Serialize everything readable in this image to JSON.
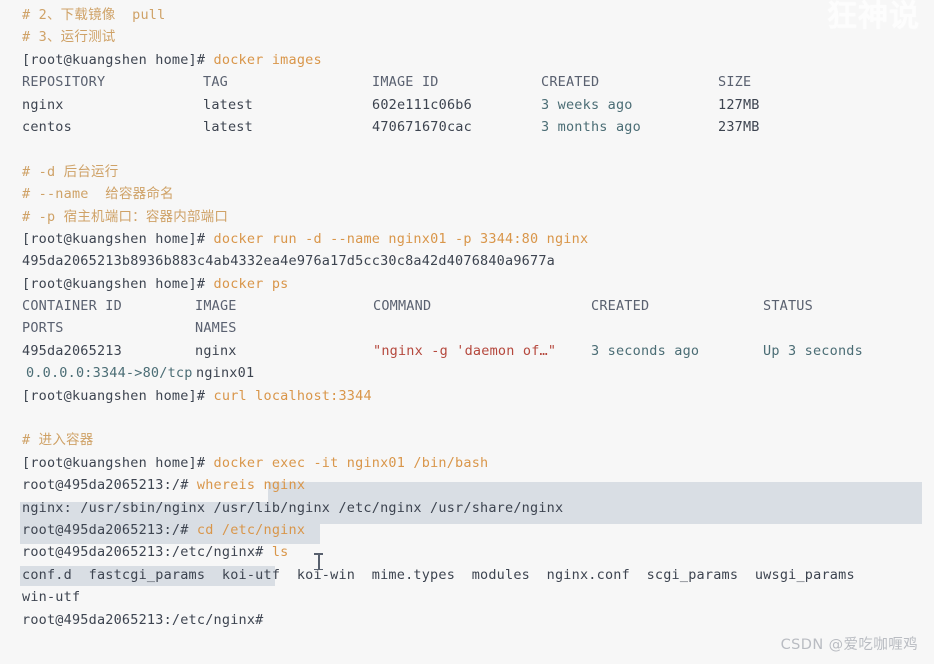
{
  "terminal": {
    "host_prompt": "[root@kuangshen home]# ",
    "container_prompt_root": "root@495da2065213:/# ",
    "container_prompt_nginx": "root@495da2065213:/etc/nginx# ",
    "lines": {
      "c1": "# 2、下载镜像  pull",
      "c2": "# 3、运行测试",
      "cmd_images": "docker images",
      "images_header": {
        "repository": "REPOSITORY",
        "tag": "TAG",
        "image_id": "IMAGE ID",
        "created": "CREATED",
        "size": "SIZE"
      },
      "images_rows": [
        {
          "repository": "nginx",
          "tag": "latest",
          "image_id": "602e111c06b6",
          "created": "3 weeks ago",
          "size": "127MB"
        },
        {
          "repository": "centos",
          "tag": "latest",
          "image_id": "470671670cac",
          "created": "3 months ago",
          "size": "237MB"
        }
      ],
      "c3": "# -d 后台运行",
      "c4": "# --name  给容器命名",
      "c5": "# -p 宿主机端口：容器内部端口",
      "cmd_run": "docker run -d --name nginx01 -p 3344:80 nginx",
      "run_output_id": "495da2065213b8936b883c4ab4332ea4e976a17d5cc30c8a42d4076840a9677a",
      "cmd_ps": "docker ps",
      "ps_header": {
        "container_id": "CONTAINER ID",
        "image": "IMAGE",
        "command": "COMMAND",
        "created": "CREATED",
        "status": "STATUS",
        "ports": "PORTS",
        "names": "NAMES"
      },
      "ps_row": {
        "container_id": "495da2065213",
        "image": "nginx",
        "command": "\"nginx -g 'daemon of…\"",
        "created": "3 seconds ago",
        "status": "Up 3 seconds",
        "ports": "0.0.0.0:3344->80/tcp",
        "names": "nginx01"
      },
      "cmd_curl": "curl localhost:3344",
      "c6": "# 进入容器",
      "cmd_exec": "docker exec -it nginx01 /bin/bash",
      "cmd_whereis": "whereis nginx",
      "whereis_output": "nginx: /usr/sbin/nginx /usr/lib/nginx /etc/nginx /usr/share/nginx",
      "cmd_cd": "cd /etc/nginx",
      "cmd_ls": "ls",
      "ls_output_1": "conf.d  fastcgi_params  koi-utf  koi-win  mime.types  modules  nginx.conf  scgi_params  uwsgi_params",
      "ls_output_2": "win-utf"
    }
  },
  "watermarks": {
    "brand": "狂神说",
    "csdn": "CSDN @爱吃咖喱鸡"
  },
  "colors": {
    "background": "#f7f7f7",
    "comment": "#cfa267",
    "command": "#d9964a",
    "output": "#3d4450",
    "header": "#5a6170",
    "value_teal": "#4b6d75",
    "command_string": "#b5483d",
    "selection": "#d9dee4",
    "watermark": "#b9bcc2"
  }
}
